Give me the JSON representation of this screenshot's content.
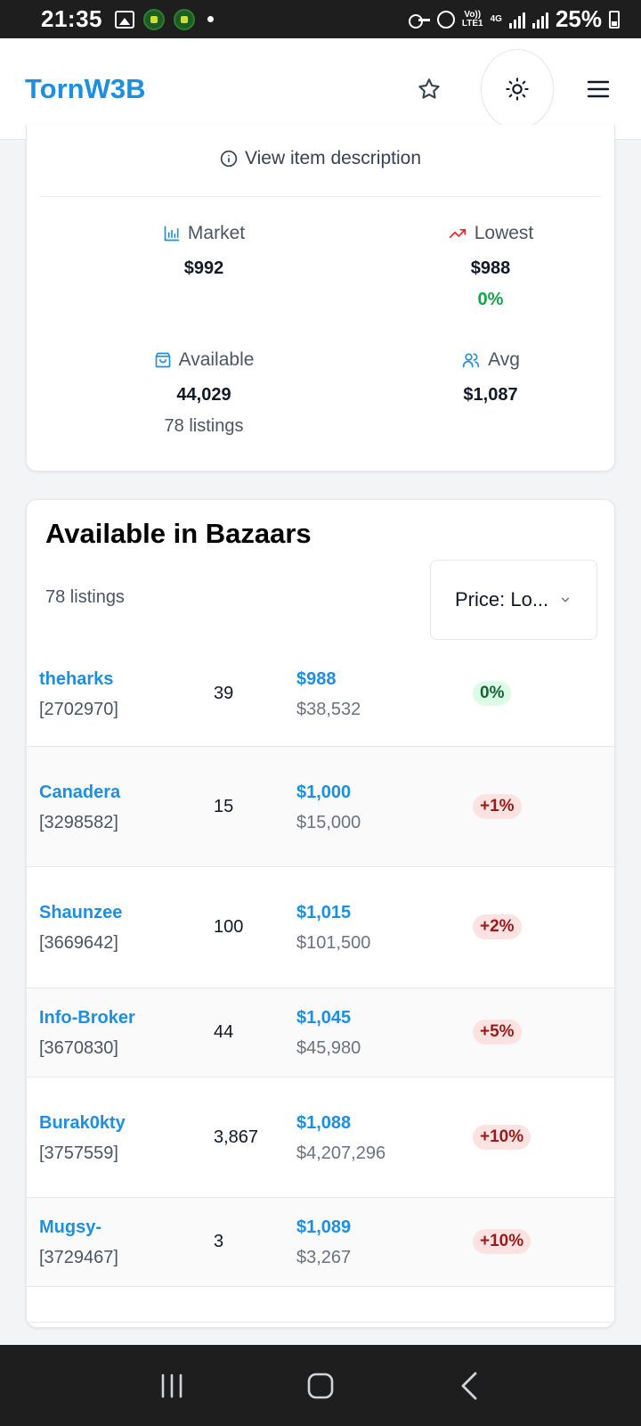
{
  "status_bar": {
    "time": "21:35",
    "network_top": "Vo))",
    "network_bottom": "LTE1",
    "network_type": "4G",
    "battery": "25%"
  },
  "header": {
    "logo": "TornW3B",
    "icons": [
      "star-icon",
      "sun-icon",
      "menu-icon"
    ]
  },
  "item_card": {
    "description_link": "View item description",
    "stats": {
      "market": {
        "label": "Market",
        "value": "$992"
      },
      "lowest": {
        "label": "Lowest",
        "value": "$988",
        "change": "0%"
      },
      "available": {
        "label": "Available",
        "value": "44,029",
        "sub": "78 listings"
      },
      "avg": {
        "label": "Avg",
        "value": "$1,087"
      }
    }
  },
  "bazaars": {
    "title": "Available in Bazaars",
    "count": "78 listings",
    "sort": "Price: Lo..."
  },
  "listings": [
    {
      "seller": "theharks",
      "id": "[2702970]",
      "qty": "39",
      "price": "$988",
      "total": "$38,532",
      "diff": "0%",
      "tone": "green"
    },
    {
      "seller": "Canadera",
      "id": "[3298582]",
      "qty": "15",
      "price": "$1,000",
      "total": "$15,000",
      "diff": "+1%",
      "tone": "red"
    },
    {
      "seller": "Shaunzee",
      "id": "[3669642]",
      "qty": "100",
      "price": "$1,015",
      "total": "$101,500",
      "diff": "+2%",
      "tone": "red"
    },
    {
      "seller": "Info-Broker",
      "id": "[3670830]",
      "qty": "44",
      "price": "$1,045",
      "total": "$45,980",
      "diff": "+5%",
      "tone": "red"
    },
    {
      "seller": "Burak0kty",
      "id": "[3757559]",
      "qty": "3,867",
      "price": "$1,088",
      "total": "$4,207,296",
      "diff": "+10%",
      "tone": "red"
    },
    {
      "seller": "Mugsy-",
      "id": "[3729467]",
      "qty": "3",
      "price": "$1,089",
      "total": "$3,267",
      "diff": "+10%",
      "tone": "red"
    }
  ],
  "colors": {
    "accent": "#1d8fe1",
    "positive": "#16a34a",
    "negative_badge_bg": "#fde2e2",
    "negative_badge_text": "#991b1b"
  }
}
